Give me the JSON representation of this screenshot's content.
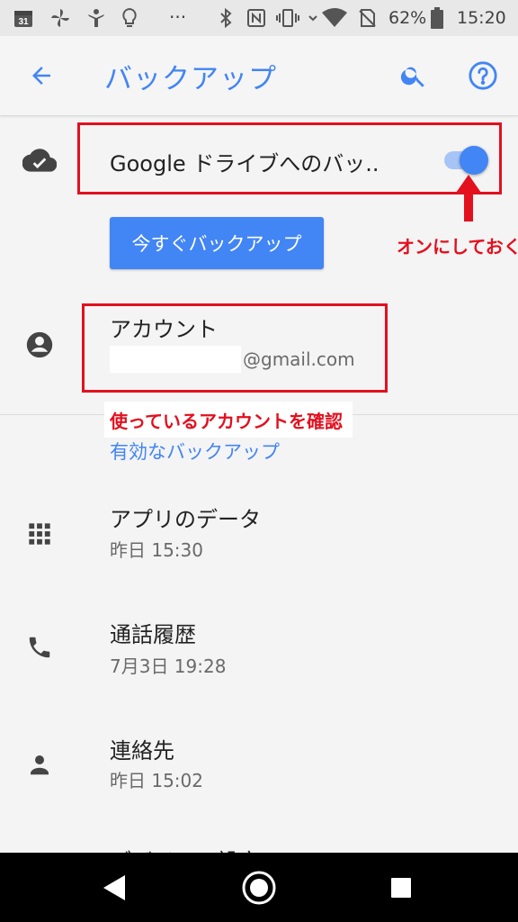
{
  "status_bar": {
    "calendar_day": "31",
    "dots": "···",
    "battery_percent": "62%",
    "time": "15:20",
    "icons": [
      "calendar-icon",
      "pinwheel-icon",
      "person-icon",
      "bulb-icon",
      "bluetooth-icon",
      "nfc-icon",
      "vibrate-icon",
      "wifi-icon",
      "no-sim-icon",
      "battery-icon"
    ]
  },
  "app_bar": {
    "title": "バックアップ",
    "icons": [
      "back-arrow-icon",
      "search-icon",
      "help-icon"
    ]
  },
  "backup_toggle": {
    "label": "Google ドライブへのバッ..",
    "enabled": true,
    "icon": "cloud-check-icon"
  },
  "backup_now_button": {
    "label": "今すぐバックアップ"
  },
  "account": {
    "label": "アカウント",
    "email": "@gmail.com",
    "icon": "account-circle-icon"
  },
  "annotations": {
    "toggle_note": "オンにしておく",
    "account_note": "使っているアカウントを確認"
  },
  "section_header": "有効なバックアップ",
  "backups": [
    {
      "title": "アプリのデータ",
      "time": "昨日 15:30",
      "icon": "apps-grid-icon"
    },
    {
      "title": "通話履歴",
      "time": "7月3日 19:28",
      "icon": "phone-icon"
    },
    {
      "title": "連絡先",
      "time": "昨日 15:02",
      "icon": "person-icon"
    },
    {
      "title": "デバイスの設定",
      "time": "",
      "icon": ""
    }
  ],
  "nav_bar": {
    "icons": [
      "back-triangle-icon",
      "home-circle-icon",
      "recents-square-icon"
    ]
  },
  "colors": {
    "accent": "#4285f4",
    "annotation_red": "#e3101e"
  }
}
